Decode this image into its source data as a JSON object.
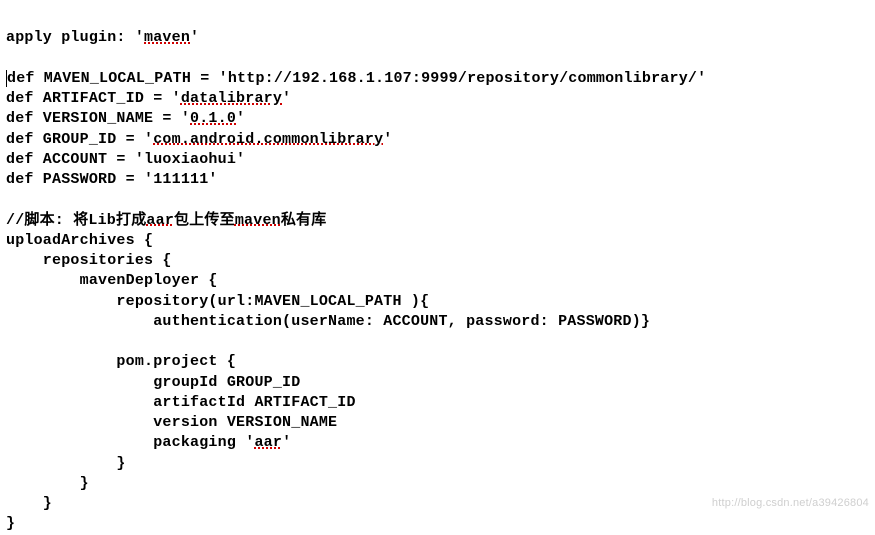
{
  "code": {
    "l1_a": "apply plugin: '",
    "l1_b": "maven",
    "l1_c": "'",
    "l3_a": "def MAVEN_LOCAL_PATH = 'http://192.168.1.107:9999/repository/commonlibrary/'",
    "l4_a": "def ARTIFACT_ID = '",
    "l4_b": "datalibrary",
    "l4_c": "'",
    "l5_a": "def VERSION_NAME = '",
    "l5_b": "0.1.0",
    "l5_c": "'",
    "l6_a": "def GROUP_ID = '",
    "l6_b": "com.android.commonlibrary",
    "l6_c": "'",
    "l7_a": "def ACCOUNT = 'luoxiaohui'",
    "l8_a": "def PASSWORD = '111111'",
    "l10_a": "//脚本: 将Lib打成",
    "l10_b": "aar",
    "l10_c": "包上传至",
    "l10_d": "maven",
    "l10_e": "私有库",
    "l11_a": "uploadArchives {",
    "l12_a": "    repositories {",
    "l13_a": "        mavenDeployer {",
    "l14_a": "            repository(url:MAVEN_LOCAL_PATH ){",
    "l15_a": "                authentication(userName: ACCOUNT, password: PASSWORD)}",
    "l17_a": "            pom.project {",
    "l18_a": "                groupId GROUP_ID",
    "l19_a": "                artifactId ARTIFACT_ID",
    "l20_a": "                version VERSION_NAME",
    "l21_a": "                packaging '",
    "l21_b": "aar",
    "l21_c": "'",
    "l22_a": "            }",
    "l23_a": "        }",
    "l24_a": "    }",
    "l25_a": "}"
  },
  "watermark": "http://blog.csdn.net/a39426804"
}
